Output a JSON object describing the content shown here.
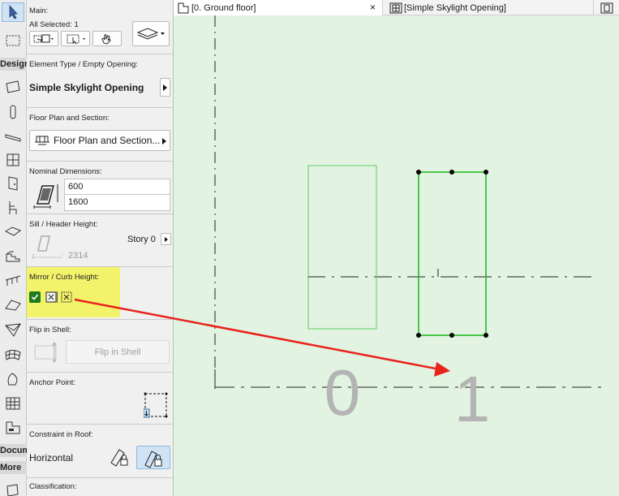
{
  "toolbox": {
    "design_label": "Design",
    "document_label": "Document",
    "more_label": "More"
  },
  "panel": {
    "main": {
      "title": "Main:",
      "all_selected": "All Selected: 1"
    },
    "element_type": {
      "title": "Element Type / Empty Opening:",
      "value": "Simple Skylight Opening"
    },
    "floor_plan": {
      "title": "Floor Plan and Section:",
      "value": "Floor Plan and Section..."
    },
    "nominal": {
      "title": "Nominal Dimensions:",
      "width": "600",
      "height": "1600"
    },
    "sill": {
      "title": "Sill / Header Height:",
      "story": "Story 0",
      "value": "2314"
    },
    "mirror": {
      "title": "Mirror / Curb Height:",
      "highlight_color": "#f3f36b"
    },
    "flip": {
      "title": "Flip in Shell:",
      "button": "Flip in Shell"
    },
    "anchor": {
      "title": "Anchor Point:"
    },
    "constraint": {
      "title": "Constraint in Roof:",
      "value": "Horizontal"
    },
    "classification": {
      "title": "Classification:"
    }
  },
  "tabs": [
    {
      "label": "[0. Ground floor]",
      "close": "×"
    },
    {
      "label": "[Simple Skylight Opening]"
    },
    {
      "label": ""
    }
  ],
  "canvas": {
    "axis_0": "0",
    "axis_1": "1",
    "element_color": "#33cc33",
    "arrow_color": "#e8231c",
    "background": "#e2f3e1"
  }
}
